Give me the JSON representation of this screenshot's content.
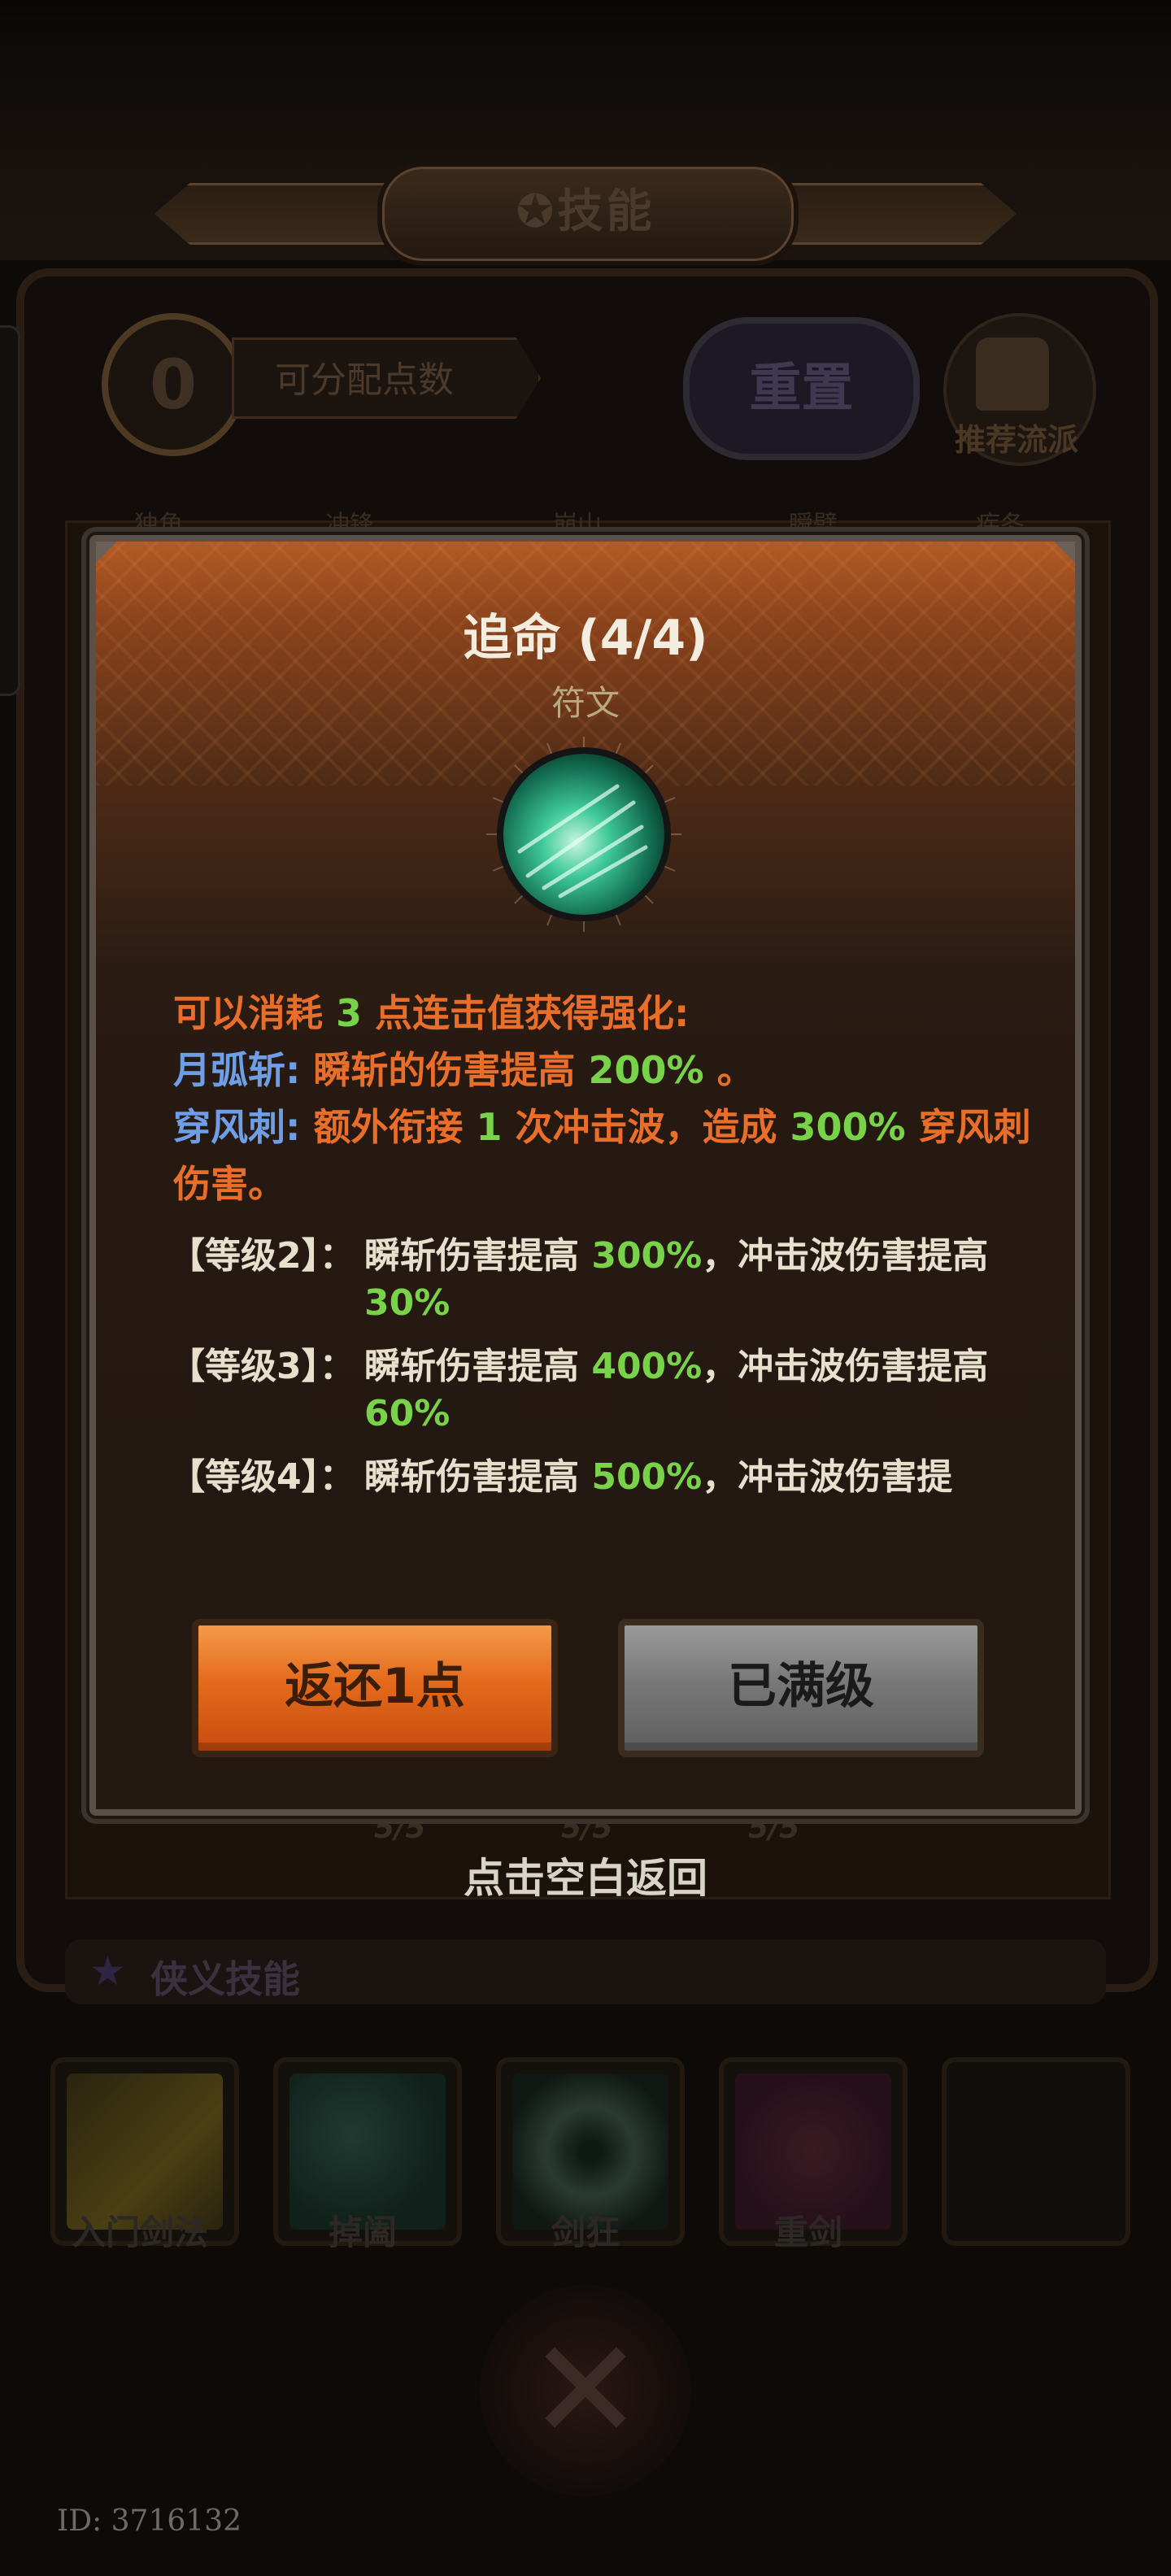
{
  "header": {
    "title": "技能"
  },
  "points": {
    "value": "0",
    "label": "可分配点数"
  },
  "reset_label": "重置",
  "recommend_label": "推荐流派",
  "background_tabs": [
    "独角",
    "冲锋",
    "崩山",
    "瞬劈",
    "疾冬"
  ],
  "background_levels": [
    "5/5",
    "5/5",
    "5/5"
  ],
  "tap_return": "点击空白返回",
  "skills_section": {
    "title": "侠义技能",
    "items": [
      {
        "label": "入门剑法"
      },
      {
        "label": "掉阖"
      },
      {
        "label": "剑狂"
      },
      {
        "label": "重剑"
      }
    ]
  },
  "id_text": "ID: 3716132",
  "modal": {
    "title": "追命 (4/4)",
    "type": "符文",
    "intro": {
      "a": "可以消耗 ",
      "n": "3",
      "b": " 点连击值获得强化:"
    },
    "line2": {
      "name": "月弧斩:",
      "a": " 瞬斩的伤害提高 ",
      "pct": "200%",
      "b": " 。"
    },
    "line3": {
      "name": "穿风刺:",
      "a": " 额外衔接 ",
      "n": "1",
      "b": " 次冲击波，造成 ",
      "pct": "300%",
      "c": " 穿风刺伤害。"
    },
    "levels": [
      {
        "label": "【等级2】：",
        "a": "瞬斩伤害提高 ",
        "p1": "300%",
        "b": "，冲击波伤害提高 ",
        "p2": "30%"
      },
      {
        "label": "【等级3】：",
        "a": "瞬斩伤害提高 ",
        "p1": "400%",
        "b": "，冲击波伤害提高 ",
        "p2": "60%"
      },
      {
        "label": "【等级4】：",
        "a": "瞬斩伤害提高 ",
        "p1": "500%",
        "b": "，冲击波伤害提"
      }
    ],
    "return_button": "返还1点",
    "max_button": "已满级"
  },
  "colors": {
    "accent_orange": "#e86e2a",
    "skill_name_blue": "#6d9ee6",
    "value_green": "#78d24a"
  }
}
